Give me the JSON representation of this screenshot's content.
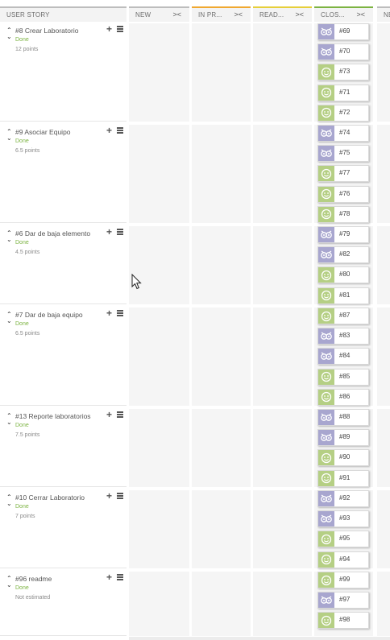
{
  "columns": [
    {
      "title": "USER STORY",
      "fold": "",
      "color": "#bdbdbd"
    },
    {
      "title": "NEW",
      "fold": "><",
      "color": "#bdbdbd"
    },
    {
      "title": "IN PR...",
      "fold": "><",
      "color": "#f0a830"
    },
    {
      "title": "READ...",
      "fold": "><",
      "color": "#e6cf3b"
    },
    {
      "title": "CLOS...",
      "fold": "><",
      "color": "#7cb342"
    },
    {
      "title": "NE",
      "fold": "",
      "color": "#bdbdbd"
    }
  ],
  "stories": [
    {
      "title": "#8 Crear Laboratorio",
      "status": "Done",
      "points": "12 points",
      "tasks": [
        {
          "ref": "#69",
          "avatar": "owl"
        },
        {
          "ref": "#70",
          "avatar": "owl"
        },
        {
          "ref": "#73",
          "avatar": "smile"
        },
        {
          "ref": "#71",
          "avatar": "smile"
        },
        {
          "ref": "#72",
          "avatar": "smile"
        }
      ]
    },
    {
      "title": "#9 Asociar Equipo",
      "status": "Done",
      "points": "6.5 points",
      "tasks": [
        {
          "ref": "#74",
          "avatar": "owl"
        },
        {
          "ref": "#75",
          "avatar": "owl"
        },
        {
          "ref": "#77",
          "avatar": "smile"
        },
        {
          "ref": "#76",
          "avatar": "smile"
        },
        {
          "ref": "#78",
          "avatar": "smile"
        }
      ]
    },
    {
      "title": "#6 Dar de baja elemento",
      "status": "Done",
      "points": "4.5 points",
      "tasks": [
        {
          "ref": "#79",
          "avatar": "owl"
        },
        {
          "ref": "#82",
          "avatar": "owl"
        },
        {
          "ref": "#80",
          "avatar": "smile"
        },
        {
          "ref": "#81",
          "avatar": "smile"
        }
      ]
    },
    {
      "title": "#7 Dar de baja equipo",
      "status": "Done",
      "points": "6.5 points",
      "tasks": [
        {
          "ref": "#87",
          "avatar": "smile"
        },
        {
          "ref": "#83",
          "avatar": "owl"
        },
        {
          "ref": "#84",
          "avatar": "owl"
        },
        {
          "ref": "#85",
          "avatar": "smile"
        },
        {
          "ref": "#86",
          "avatar": "smile"
        }
      ]
    },
    {
      "title": "#13 Reporte laboratorios",
      "status": "Done",
      "points": "7.5 points",
      "tasks": [
        {
          "ref": "#88",
          "avatar": "owl"
        },
        {
          "ref": "#89",
          "avatar": "owl"
        },
        {
          "ref": "#90",
          "avatar": "smile"
        },
        {
          "ref": "#91",
          "avatar": "smile"
        }
      ]
    },
    {
      "title": "#10 Cerrar Laboratorio",
      "status": "Done",
      "points": "7 points",
      "tasks": [
        {
          "ref": "#92",
          "avatar": "owl"
        },
        {
          "ref": "#93",
          "avatar": "owl"
        },
        {
          "ref": "#95",
          "avatar": "smile"
        },
        {
          "ref": "#94",
          "avatar": "smile"
        }
      ]
    },
    {
      "title": "#96 readme",
      "status": "Done",
      "points": "Not estimated",
      "tasks": [
        {
          "ref": "#99",
          "avatar": "smile"
        },
        {
          "ref": "#97",
          "avatar": "owl"
        },
        {
          "ref": "#98",
          "avatar": "smile"
        }
      ]
    }
  ]
}
